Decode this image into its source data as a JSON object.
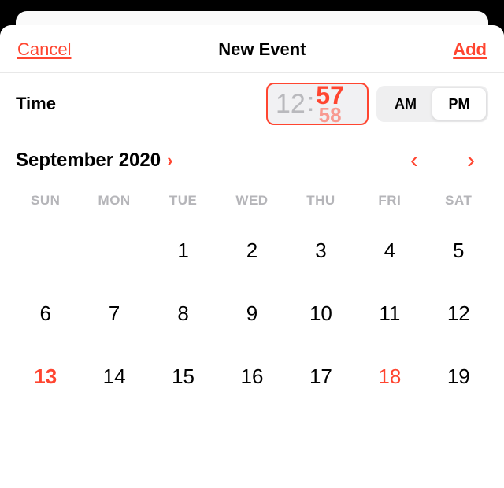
{
  "header": {
    "cancel": "Cancel",
    "title": "New Event",
    "add": "Add"
  },
  "time": {
    "label": "Time",
    "hour": "12",
    "minute": "57",
    "minute_next": "58",
    "am": "AM",
    "pm": "PM",
    "selected_period": "PM"
  },
  "month": {
    "label": "September 2020"
  },
  "weekdays": [
    "SUN",
    "MON",
    "TUE",
    "WED",
    "THU",
    "FRI",
    "SAT"
  ],
  "days": [
    {
      "n": "",
      "empty": true
    },
    {
      "n": "",
      "empty": true
    },
    {
      "n": "1"
    },
    {
      "n": "2"
    },
    {
      "n": "3"
    },
    {
      "n": "4"
    },
    {
      "n": "5"
    },
    {
      "n": "6"
    },
    {
      "n": "7"
    },
    {
      "n": "8"
    },
    {
      "n": "9"
    },
    {
      "n": "10"
    },
    {
      "n": "11"
    },
    {
      "n": "12"
    },
    {
      "n": "13",
      "selected": true
    },
    {
      "n": "14"
    },
    {
      "n": "15"
    },
    {
      "n": "16"
    },
    {
      "n": "17"
    },
    {
      "n": "18",
      "has_event": true
    },
    {
      "n": "19"
    }
  ]
}
